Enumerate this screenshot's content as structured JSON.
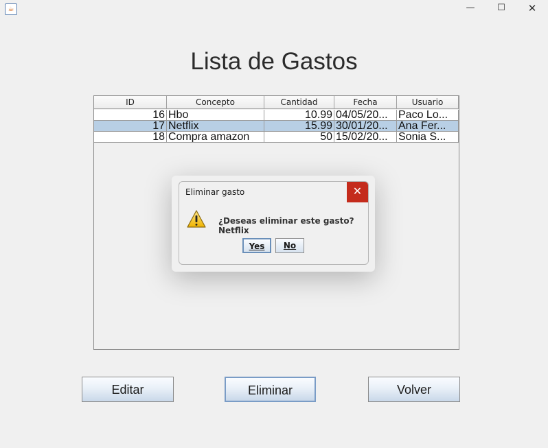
{
  "window": {
    "icon": "java-icon",
    "controls": {
      "minimize": "—",
      "maximize": "☐",
      "close": "✕"
    }
  },
  "page": {
    "title": "Lista de Gastos"
  },
  "table": {
    "columns": [
      "ID",
      "Concepto",
      "Cantidad",
      "Fecha",
      "Usuario"
    ],
    "rows": [
      {
        "id": "16",
        "concepto": "Hbo",
        "cantidad": "10.99",
        "fecha": "04/05/20...",
        "usuario": "Paco Lo...",
        "selected": false
      },
      {
        "id": "17",
        "concepto": "Netflix",
        "cantidad": "15.99",
        "fecha": "30/01/20...",
        "usuario": "Ana Fer...",
        "selected": true
      },
      {
        "id": "18",
        "concepto": "Compra amazon",
        "cantidad": "50",
        "fecha": "15/02/20...",
        "usuario": "Sonia S...",
        "selected": false
      }
    ]
  },
  "dialog": {
    "title": "Eliminar gasto",
    "close": "✕",
    "message": "¿Deseas eliminar este gasto? Netflix",
    "icon": "warning-icon",
    "yes_label": "Yes",
    "no_label": "No"
  },
  "buttons": {
    "edit": "Editar",
    "delete": "Eliminar",
    "back": "Volver"
  },
  "colors": {
    "selection": "#b8cfe5",
    "close_red": "#c42b1c"
  }
}
